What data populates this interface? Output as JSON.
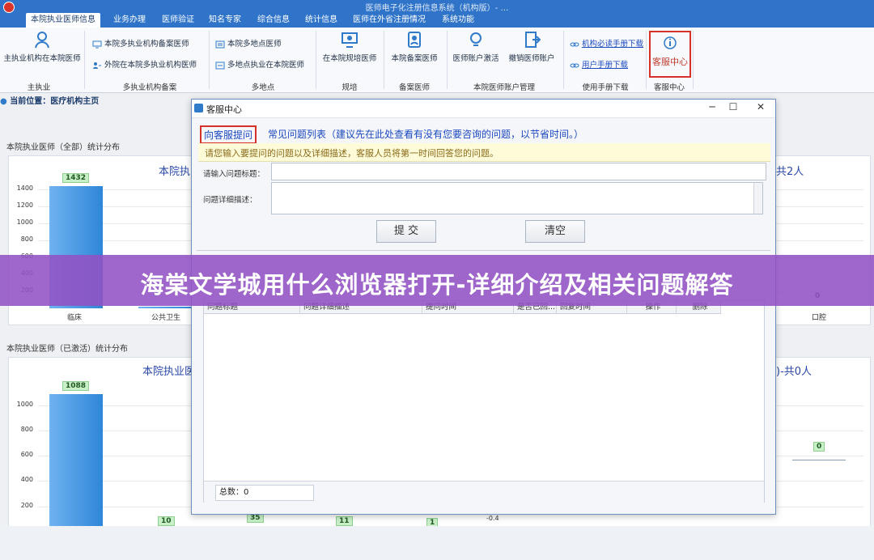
{
  "window": {
    "title": "医师电子化注册信息系统（机构版）- …"
  },
  "tabs": [
    "本院执业医师信息",
    "业务办理",
    "医师验证",
    "知名专家",
    "综合信息",
    "统计信息",
    "医师在外省注册情况",
    "系统功能"
  ],
  "ribbon": {
    "main_btn": "主执业机构在本院医师",
    "group_main": "主执业",
    "multi_rows": [
      "本院多执业机构备案医师",
      "外院在本院多执业机构医师"
    ],
    "group_multi": "多执业机构备案",
    "site_rows": [
      "本院多地点医师",
      "多地点执业在本院医师"
    ],
    "group_site": "多地点",
    "plan_btn": "在本院规培医师",
    "group_plan": "规培",
    "record_btn": "本院备案医师",
    "group_record": "备案医师",
    "activate_btn": "医师账户激活",
    "cancel_btn": "撤销医师账户",
    "group_account": "本院医师账户管理",
    "manual1": "机构必读手册下载",
    "manual2": "用户手册下载",
    "group_manual": "使用手册下载",
    "kefu_btn": "客服中心",
    "group_kefu": "客服中心"
  },
  "breadcrumb": "当前位置：医疗机构主页",
  "charts": {
    "top": {
      "panel_title": "本院执业医师（全部）统计分布",
      "title": "本院执",
      "right_title": "共2人",
      "yticks": [
        "1400",
        "1200",
        "1000",
        "800",
        "600",
        "400",
        "200"
      ],
      "bar_label": "1432",
      "second_label": "17",
      "xticks": [
        "临床",
        "公共卫生"
      ],
      "right_tick": "口腔",
      "right_value": "0"
    },
    "bottom": {
      "panel_title": "本院执业医师（已激活）统计分布",
      "title": "本院执业医",
      "right_title": ")-共0人",
      "yticks": [
        "1000",
        "800",
        "600",
        "400",
        "200"
      ],
      "bar_label": "1088",
      "small_labels": [
        "10",
        "35",
        "11",
        "1"
      ],
      "right_value": "0",
      "right_tick": "-0.4"
    }
  },
  "chart_data": [
    {
      "type": "bar",
      "title": "本院执",
      "categories": [
        "临床",
        "公共卫生"
      ],
      "values": [
        1432,
        17
      ],
      "ylim": [
        0,
        1500
      ]
    },
    {
      "type": "bar",
      "title": "本院执业医",
      "categories": [
        "临床"
      ],
      "values": [
        1088
      ],
      "ylim": [
        0,
        1100
      ]
    }
  ],
  "dialog": {
    "title": "客服中心",
    "tab_submit": "向客服提问",
    "tab_faq": "常见问题列表（建议先在此处查看有没有您要咨询的问题，以节省时间。）",
    "notice": "请您输入要提问的问题以及详细描述，客服人员将第一时间回答您的问题。",
    "label_title": "请输入问题标题：",
    "label_desc": "问题详细描述：",
    "submit_btn": "提 交",
    "clear_btn": "清空",
    "columns": [
      "问题标题",
      "问题详细描述",
      "提问时间",
      "是否已回...",
      "回复时间",
      "操作",
      "删除"
    ],
    "count": "总数：0"
  },
  "overlay": {
    "headline": "海棠文学城用什么浏览器打开-详细介绍及相关问题解答"
  }
}
